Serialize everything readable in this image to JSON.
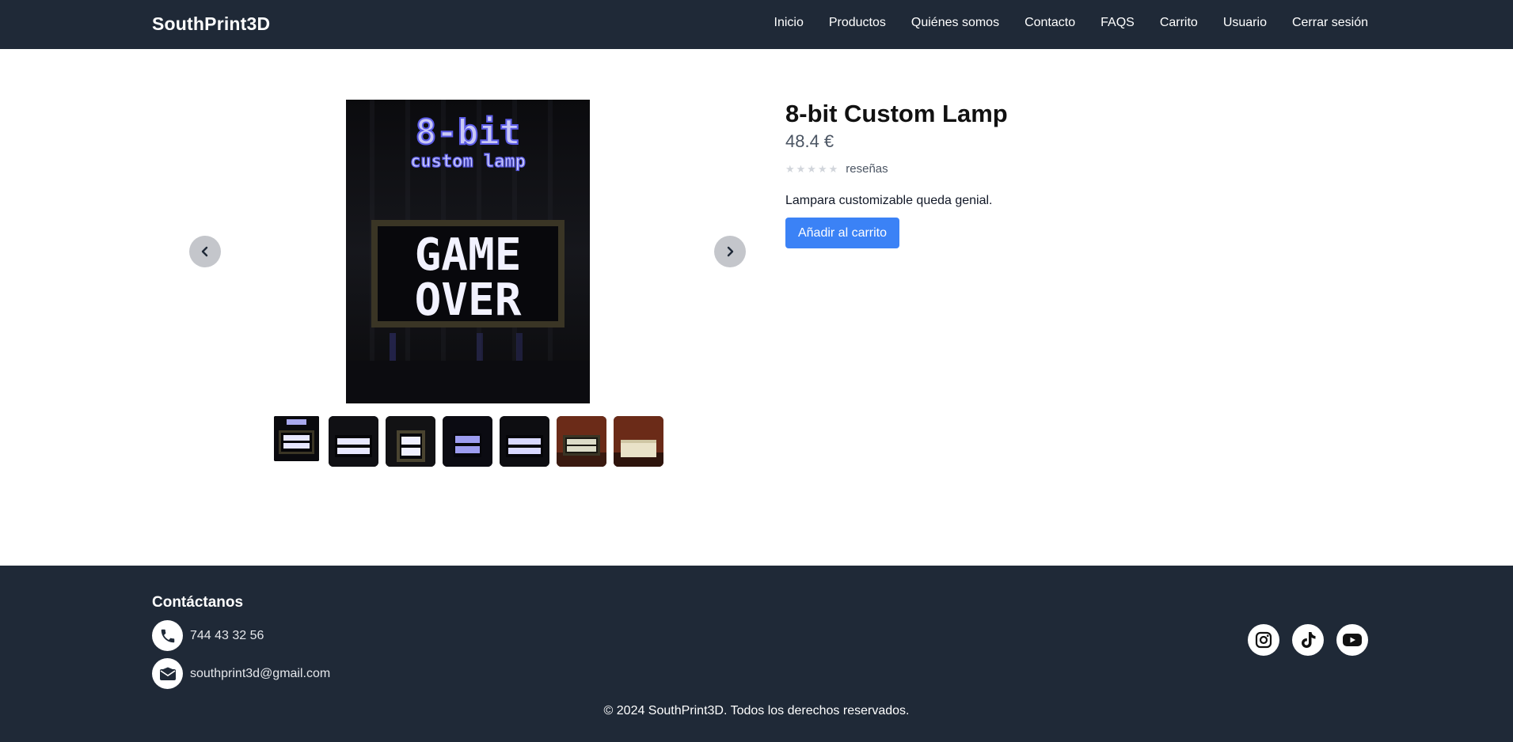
{
  "header": {
    "brand": "SouthPrint3D",
    "nav": [
      "Inicio",
      "Productos",
      "Quiénes somos",
      "Contacto",
      "FAQS",
      "Carrito",
      "Usuario",
      "Cerrar sesión"
    ]
  },
  "product": {
    "image_heading": "8-bit",
    "image_subheading": "custom lamp",
    "image_sign_line1": "GAME",
    "image_sign_line2": "OVER",
    "title": "8-bit Custom Lamp",
    "price": "48.4 €",
    "rating_stars": "★★★★★",
    "reviews_label": "reseñas",
    "description": "Lampara customizable queda genial.",
    "add_to_cart": "Añadir al carrito",
    "thumbnails": 7,
    "rating_value": 0
  },
  "footer": {
    "title": "Contáctanos",
    "phone": "744 43 32 56",
    "email": "southprint3d@gmail.com",
    "socials": [
      "instagram-icon",
      "tiktok-icon",
      "youtube-icon"
    ],
    "copyright": "© 2024 SouthPrint3D. Todos los derechos reservados."
  },
  "colors": {
    "header_bg": "#1f2937",
    "accent": "#3b82f6",
    "footer_bg": "#1f2937"
  }
}
